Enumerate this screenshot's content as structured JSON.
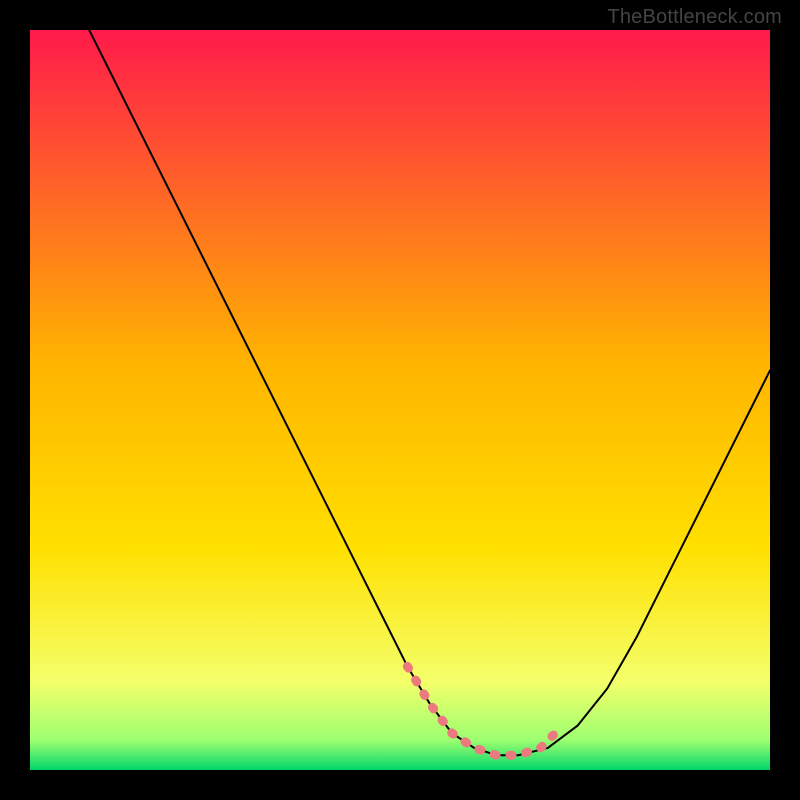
{
  "watermark": "TheBottleneck.com",
  "chart_data": {
    "type": "line",
    "title": "",
    "xlabel": "",
    "ylabel": "",
    "xlim": [
      0,
      100
    ],
    "ylim": [
      0,
      100
    ],
    "grid": false,
    "note": "Numeric scales inferred — no axis labels visible.",
    "background_gradient_colors": [
      "#ff1a4b",
      "#ffd400",
      "#d6ff66",
      "#00d66b"
    ],
    "series": [
      {
        "name": "curve",
        "stroke": "#000000",
        "x": [
          8,
          12,
          16,
          20,
          24,
          28,
          32,
          36,
          40,
          44,
          48,
          51,
          54,
          57,
          60,
          63,
          66,
          70,
          74,
          78,
          82,
          86,
          90,
          94,
          98,
          100
        ],
        "y": [
          100,
          92,
          84,
          76,
          68,
          60,
          52,
          44,
          36,
          28,
          20,
          14,
          9,
          5,
          3,
          2,
          2,
          3,
          6,
          11,
          18,
          26,
          34,
          42,
          50,
          54
        ]
      },
      {
        "name": "highlight",
        "stroke": "#eb7a7f",
        "x": [
          51,
          54,
          57,
          60,
          63,
          66,
          69,
          71
        ],
        "y": [
          14,
          9,
          5,
          3,
          2,
          2,
          3,
          5
        ]
      }
    ]
  }
}
